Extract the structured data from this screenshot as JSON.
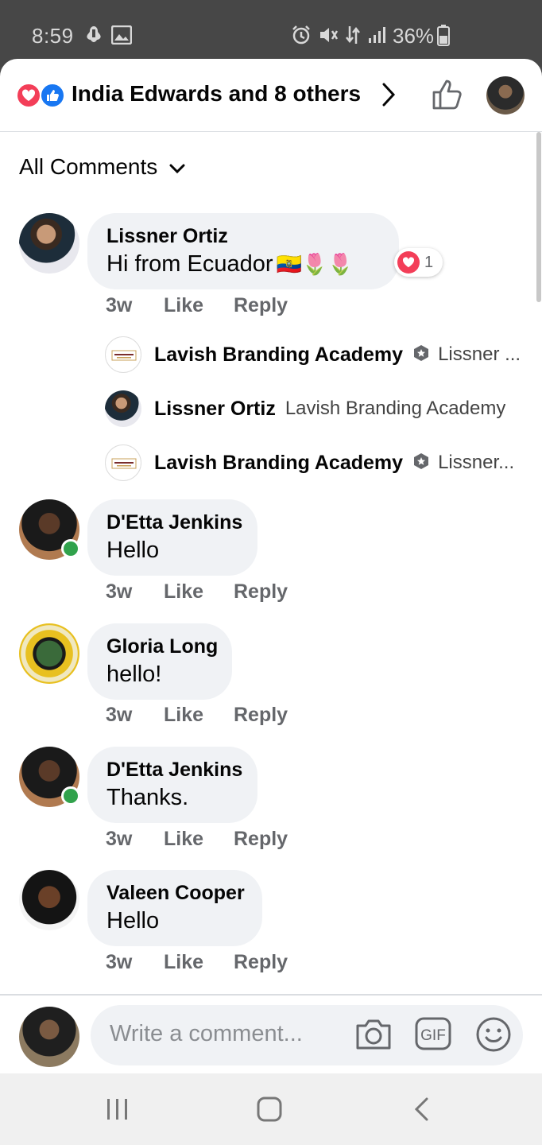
{
  "status_bar": {
    "time": "8:59",
    "battery": "36%"
  },
  "header": {
    "title": "India Edwards and 8 others"
  },
  "filter": {
    "label": "All Comments"
  },
  "comments": [
    {
      "name": "Lissner Ortiz",
      "text": "Hi from Ecuador",
      "emoji": "🇪🇨🌷🌷",
      "time": "3w",
      "like": "Like",
      "reply": "Reply",
      "reaction_count": "1"
    },
    {
      "name": "D'Etta Jenkins",
      "text": "Hello",
      "time": "3w",
      "like": "Like",
      "reply": "Reply"
    },
    {
      "name": "Gloria Long",
      "text": "hello!",
      "time": "3w",
      "like": "Like",
      "reply": "Reply"
    },
    {
      "name": "D'Etta Jenkins",
      "text": "Thanks.",
      "time": "3w",
      "like": "Like",
      "reply": "Reply"
    },
    {
      "name": "Valeen Cooper",
      "text": "Hello",
      "time": "3w",
      "like": "Like",
      "reply": "Reply"
    }
  ],
  "replies": [
    {
      "name": "Lavish Branding Academy",
      "text": "Lissner ..."
    },
    {
      "name": "Lissner Ortiz",
      "text": "Lavish Branding Academy"
    },
    {
      "name": "Lavish Branding Academy",
      "text": "Lissner..."
    }
  ],
  "composer": {
    "placeholder": "Write a comment...",
    "gif_label": "GIF"
  },
  "colors": {
    "like_blue": "#1877f2",
    "love_red": "#f33e58",
    "online_green": "#31a24c",
    "bubble_gray": "#f0f2f5"
  }
}
